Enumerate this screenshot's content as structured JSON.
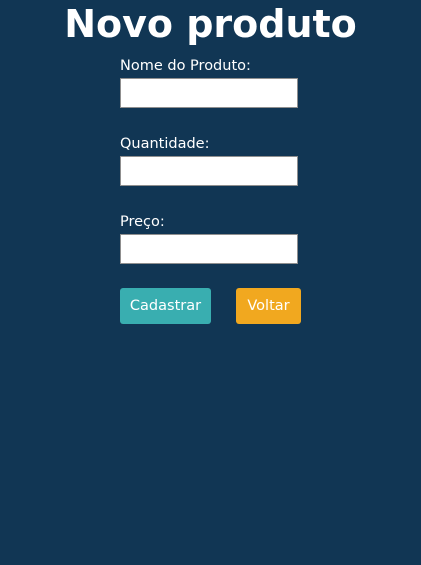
{
  "page": {
    "title": "Novo produto"
  },
  "form": {
    "fields": [
      {
        "label": "Nome do Produto:",
        "value": "",
        "placeholder": ""
      },
      {
        "label": "Quantidade:",
        "value": "",
        "placeholder": ""
      },
      {
        "label": "Preço:",
        "value": "",
        "placeholder": ""
      }
    ],
    "submit_label": "Cadastrar",
    "back_label": "Voltar"
  },
  "colors": {
    "background": "#113654",
    "submit_button": "#39aeb0",
    "back_button": "#f1a81f",
    "text": "#ffffff"
  }
}
